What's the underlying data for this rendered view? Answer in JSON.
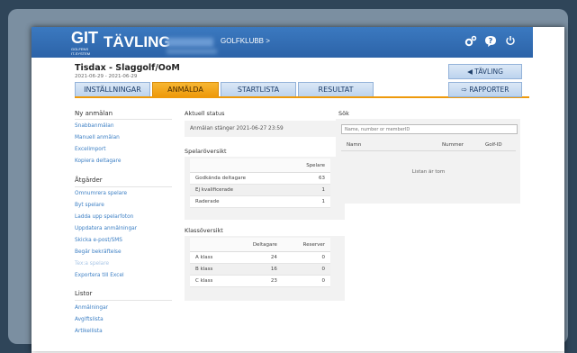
{
  "header": {
    "logo_main": "GIT",
    "logo_sub_1": "GOLFENS",
    "logo_sub_2": "IT-SYSTEM",
    "title": "TÄVLING",
    "club_name": "GOLFKLUBB >",
    "icons": [
      "gear-icon",
      "help-icon",
      "power-icon"
    ]
  },
  "event": {
    "title": "Tisdax - Slaggolf/OoM",
    "dates": "2021-06-29 - 2021-06-29"
  },
  "tabs": [
    {
      "label": "INSTÄLLNINGAR",
      "active": false
    },
    {
      "label": "ANMÄLDA",
      "active": true
    },
    {
      "label": "STARTLISTA",
      "active": false
    },
    {
      "label": "RESULTAT",
      "active": false
    }
  ],
  "right_buttons": {
    "tavling": "TÄVLING",
    "rapporter": "RAPPORTER"
  },
  "sidebar": {
    "sections": [
      {
        "heading": "Ny anmälan",
        "links": [
          {
            "label": "Snabbanmälan",
            "disabled": false
          },
          {
            "label": "Manuell anmälan",
            "disabled": false
          },
          {
            "label": "Excelimport",
            "disabled": false
          },
          {
            "label": "Kopiera deltagare",
            "disabled": false
          }
        ]
      },
      {
        "heading": "Åtgärder",
        "links": [
          {
            "label": "Omnumrera spelare",
            "disabled": false
          },
          {
            "label": "Byt spelare",
            "disabled": false
          },
          {
            "label": "Ladda upp spelarfoton",
            "disabled": false
          },
          {
            "label": "Uppdatera anmälningar",
            "disabled": false
          },
          {
            "label": "Skicka e-post/SMS",
            "disabled": false
          },
          {
            "label": "Begär bekräftelse",
            "disabled": false
          },
          {
            "label": "Tex:a spelare",
            "disabled": true
          },
          {
            "label": "Exportera till Excel",
            "disabled": false
          }
        ]
      },
      {
        "heading": "Listor",
        "links": [
          {
            "label": "Anmälningar",
            "disabled": false
          },
          {
            "label": "Avgiftslista",
            "disabled": false
          },
          {
            "label": "Artikellista",
            "disabled": false
          }
        ]
      }
    ]
  },
  "status": {
    "heading": "Aktuell status",
    "text": "Anmälan stänger 2021-06-27 23:59"
  },
  "player_overview": {
    "heading": "Spelaröversikt",
    "column": "Spelare",
    "rows": [
      {
        "label": "Godkända deltagare",
        "value": "63"
      },
      {
        "label": "Ej kvalificerade",
        "value": "1"
      },
      {
        "label": "Raderade",
        "value": "1"
      }
    ]
  },
  "class_overview": {
    "heading": "Klassöversikt",
    "columns": [
      "",
      "Deltagare",
      "Reserver"
    ],
    "rows": [
      {
        "label": "A klass",
        "deltagare": "24",
        "reserver": "0"
      },
      {
        "label": "B klass",
        "deltagare": "16",
        "reserver": "0"
      },
      {
        "label": "C klass",
        "deltagare": "23",
        "reserver": "0"
      }
    ]
  },
  "search": {
    "heading": "Sök",
    "placeholder": "Name, number or memberID",
    "columns": [
      "Namn",
      "Nummer",
      "Golf-ID"
    ],
    "empty_text": "Listan är tom"
  },
  "colors": {
    "header_blue": "#2c63a8",
    "active_tab": "#ee9a0c",
    "link_blue": "#3c7fc4"
  }
}
